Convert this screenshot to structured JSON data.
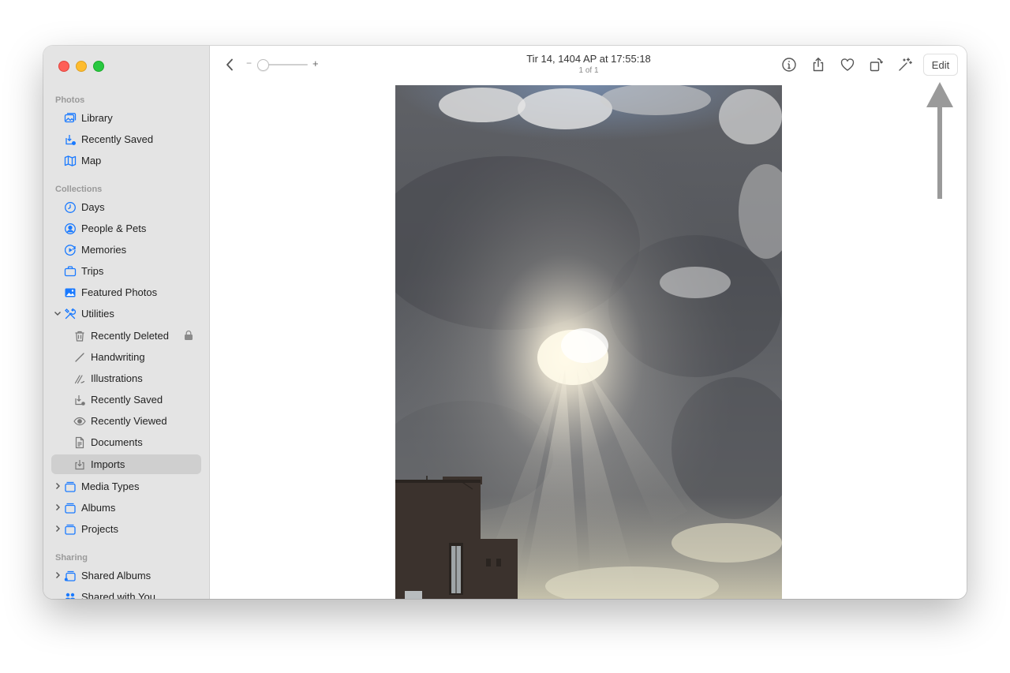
{
  "window": {
    "traffic_lights": [
      "close",
      "minimize",
      "zoom"
    ]
  },
  "sidebar": {
    "sections": {
      "photos": "Photos",
      "collections": "Collections",
      "sharing": "Sharing"
    },
    "items": {
      "library": "Library",
      "recently_saved": "Recently Saved",
      "map": "Map",
      "days": "Days",
      "people_pets": "People & Pets",
      "memories": "Memories",
      "trips": "Trips",
      "featured_photos": "Featured Photos",
      "utilities": "Utilities",
      "recently_deleted": "Recently Deleted",
      "handwriting": "Handwriting",
      "illustrations": "Illustrations",
      "utilities_recently_saved": "Recently Saved",
      "recently_viewed": "Recently Viewed",
      "documents": "Documents",
      "imports": "Imports",
      "media_types": "Media Types",
      "albums": "Albums",
      "projects": "Projects",
      "shared_albums": "Shared Albums",
      "shared_with_you": "Shared with You"
    },
    "selected": "imports"
  },
  "toolbar": {
    "zoom_minus": "−",
    "zoom_plus": "+",
    "zoom_level": 0.0,
    "date": "Tir 14, 1404 AP at 17:55:18",
    "count": "1 of 1",
    "edit_label": "Edit",
    "icons": [
      "back-chevron-icon",
      "info-icon",
      "share-icon",
      "heart-icon",
      "rotate-icon",
      "magic-wand-icon"
    ]
  },
  "photo": {
    "subject": "sun-rays-through-clouds"
  },
  "colors": {
    "sidebar_bg": "#e4e4e4",
    "accent": "#1a7aff",
    "selected_row": "#cfcfcf",
    "annotation_arrow": "#9a9a9a"
  }
}
